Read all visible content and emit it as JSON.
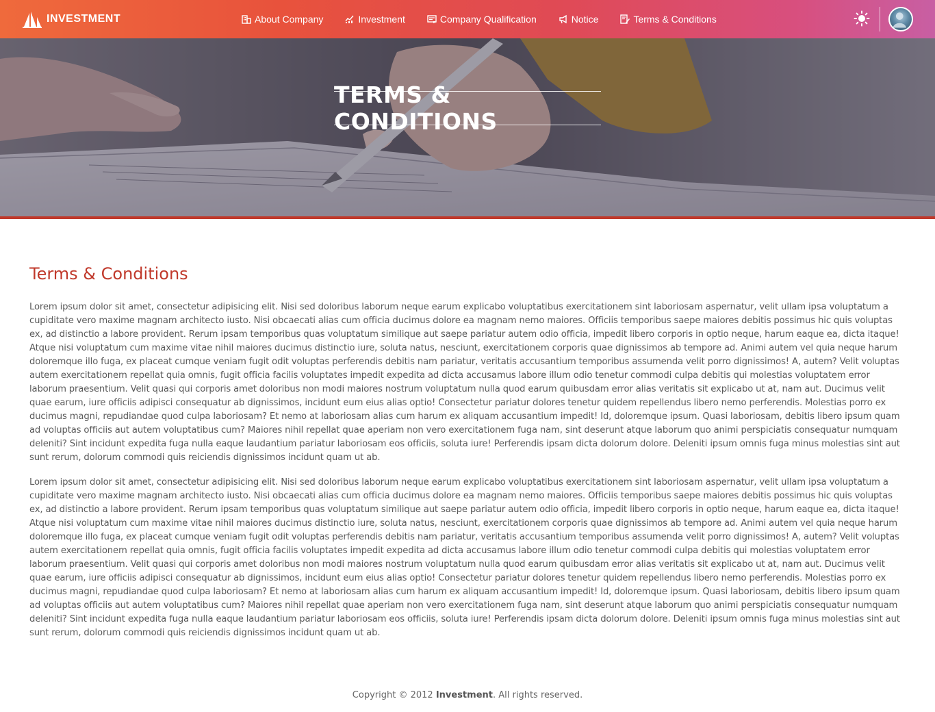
{
  "brand": {
    "name": "INVESTMENT"
  },
  "nav": {
    "items": [
      {
        "label": "About Company",
        "icon": "building-icon"
      },
      {
        "label": "Investment",
        "icon": "chart-icon"
      },
      {
        "label": "Company Qualification",
        "icon": "certificate-icon"
      },
      {
        "label": "Notice",
        "icon": "megaphone-icon"
      },
      {
        "label": "Terms & Conditions",
        "icon": "document-edit-icon"
      }
    ],
    "theme_icon": "sun-icon",
    "avatar_icon": "avatar"
  },
  "hero": {
    "title": "TERMS & CONDITIONS"
  },
  "main": {
    "title": "Terms & Conditions",
    "paragraphs": [
      "Lorem ipsum dolor sit amet, consectetur adipisicing elit. Nisi sed doloribus laborum neque earum explicabo voluptatibus exercitationem sint laboriosam aspernatur, velit ullam ipsa voluptatum a cupiditate vero maxime magnam architecto iusto. Nisi obcaecati alias cum officia ducimus dolore ea magnam nemo maiores. Officiis temporibus saepe maiores debitis possimus hic quis voluptas ex, ad distinctio a labore provident. Rerum ipsam temporibus quas voluptatum similique aut saepe pariatur autem odio officia, impedit libero corporis in optio neque, harum eaque ea, dicta itaque! Atque nisi voluptatum cum maxime vitae nihil maiores ducimus distinctio iure, soluta natus, nesciunt, exercitationem corporis quae dignissimos ab tempore ad. Animi autem vel quia neque harum doloremque illo fuga, ex placeat cumque veniam fugit odit voluptas perferendis debitis nam pariatur, veritatis accusantium temporibus assumenda velit porro dignissimos! A, autem? Velit voluptas autem exercitationem repellat quia omnis, fugit officia facilis voluptates impedit expedita ad dicta accusamus labore illum odio tenetur commodi culpa debitis qui molestias voluptatem error laborum praesentium. Velit quasi qui corporis amet doloribus non modi maiores nostrum voluptatum nulla quod earum quibusdam error alias veritatis sit explicabo ut at, nam aut. Ducimus velit quae earum, iure officiis adipisci consequatur ab dignissimos, incidunt eum eius alias optio! Consectetur pariatur dolores tenetur quidem repellendus libero nemo perferendis. Molestias porro ex ducimus magni, repudiandae quod culpa laboriosam? Et nemo at laboriosam alias cum harum ex aliquam accusantium impedit! Id, doloremque ipsum. Quasi laboriosam, debitis libero ipsum quam ad voluptas officiis aut autem voluptatibus cum? Maiores nihil repellat quae aperiam non vero exercitationem fuga nam, sint deserunt atque laborum quo animi perspiciatis consequatur numquam deleniti? Sint incidunt expedita fuga nulla eaque laudantium pariatur laboriosam eos officiis, soluta iure! Perferendis ipsam dicta dolorum dolore. Deleniti ipsum omnis fuga minus molestias sint aut sunt rerum, dolorum commodi quis reiciendis dignissimos incidunt quam ut ab.",
      "Lorem ipsum dolor sit amet, consectetur adipisicing elit. Nisi sed doloribus laborum neque earum explicabo voluptatibus exercitationem sint laboriosam aspernatur, velit ullam ipsa voluptatum a cupiditate vero maxime magnam architecto iusto. Nisi obcaecati alias cum officia ducimus dolore ea magnam nemo maiores. Officiis temporibus saepe maiores debitis possimus hic quis voluptas ex, ad distinctio a labore provident. Rerum ipsam temporibus quas voluptatum similique aut saepe pariatur autem odio officia, impedit libero corporis in optio neque, harum eaque ea, dicta itaque! Atque nisi voluptatum cum maxime vitae nihil maiores ducimus distinctio iure, soluta natus, nesciunt, exercitationem corporis quae dignissimos ab tempore ad. Animi autem vel quia neque harum doloremque illo fuga, ex placeat cumque veniam fugit odit voluptas perferendis debitis nam pariatur, veritatis accusantium temporibus assumenda velit porro dignissimos! A, autem? Velit voluptas autem exercitationem repellat quia omnis, fugit officia facilis voluptates impedit expedita ad dicta accusamus labore illum odio tenetur commodi culpa debitis qui molestias voluptatem error laborum praesentium. Velit quasi qui corporis amet doloribus non modi maiores nostrum voluptatum nulla quod earum quibusdam error alias veritatis sit explicabo ut at, nam aut. Ducimus velit quae earum, iure officiis adipisci consequatur ab dignissimos, incidunt eum eius alias optio! Consectetur pariatur dolores tenetur quidem repellendus libero nemo perferendis. Molestias porro ex ducimus magni, repudiandae quod culpa laboriosam? Et nemo at laboriosam alias cum harum ex aliquam accusantium impedit! Id, doloremque ipsum. Quasi laboriosam, debitis libero ipsum quam ad voluptas officiis aut autem voluptatibus cum? Maiores nihil repellat quae aperiam non vero exercitationem fuga nam, sint deserunt atque laborum quo animi perspiciatis consequatur numquam deleniti? Sint incidunt expedita fuga nulla eaque laudantium pariatur laboriosam eos officiis, soluta iure! Perferendis ipsam dicta dolorum dolore. Deleniti ipsum omnis fuga minus molestias sint aut sunt rerum, dolorum commodi quis reiciendis dignissimos incidunt quam ut ab."
    ]
  },
  "footer": {
    "prefix": "Copyright © 2012",
    "brand": "Investment",
    "suffix": ". All rights reserved."
  },
  "colors": {
    "accent": "#c0392b",
    "nav_gradient_start": "#ef6a3c",
    "nav_gradient_end": "#c85fa3"
  }
}
